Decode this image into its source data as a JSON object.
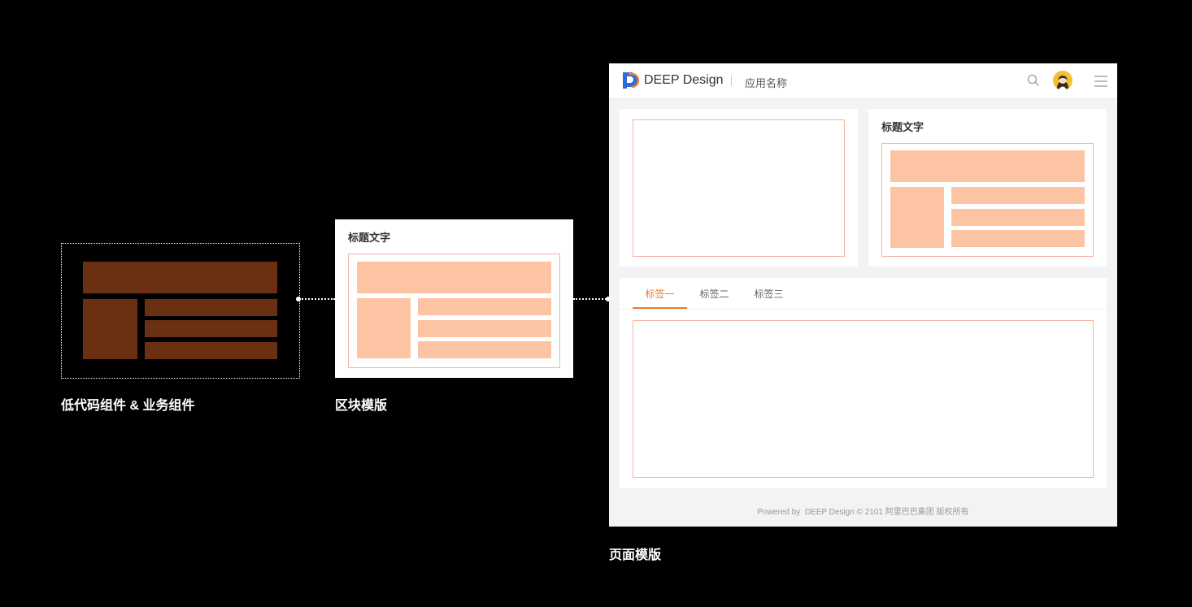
{
  "stages": [
    {
      "caption": "低代码组件 & 业务组件"
    },
    {
      "caption": "区块模版",
      "block_title": "标题文字"
    },
    {
      "caption": "页面模版"
    }
  ],
  "page_template": {
    "brand_name": "DEEP Design",
    "app_name": "应用名称",
    "card_title": "标题文字",
    "tabs": [
      "标签一",
      "标签二",
      "标签三"
    ],
    "active_tab_index": 0,
    "footer": "Powered by  DEEP Design © 2101 阿里巴巴集团 版权所有"
  },
  "colors": {
    "dark_block": "#6b3012",
    "peach_block": "#fdc4a4",
    "accent": "#f07b2b",
    "logo_blue": "#2b6fd6"
  }
}
